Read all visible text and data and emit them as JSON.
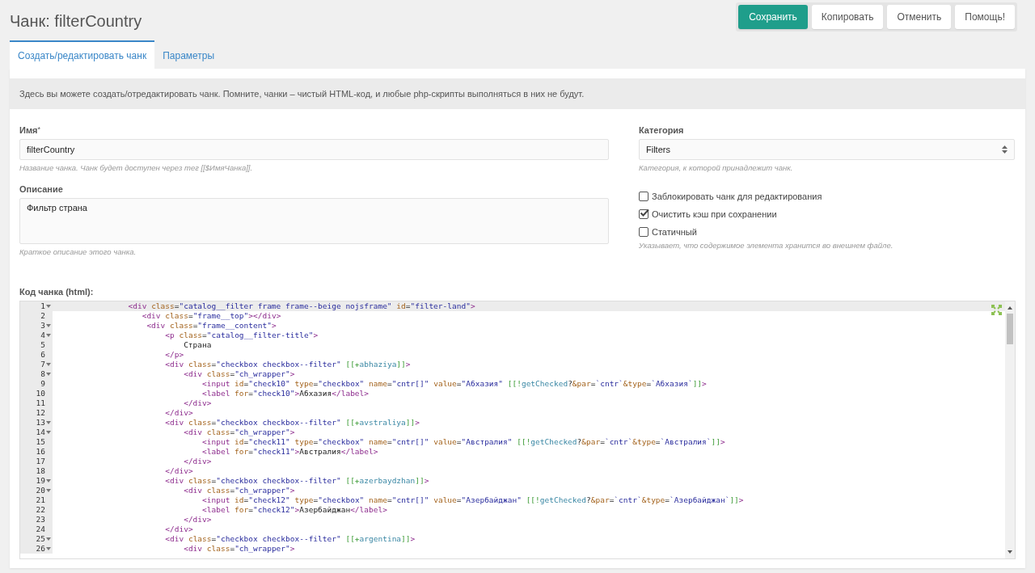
{
  "title": "Чанк: filterCountry",
  "buttons": [
    {
      "label": "Сохранить",
      "kind": "primary"
    },
    {
      "label": "Копировать",
      "kind": "default"
    },
    {
      "label": "Отменить",
      "kind": "default"
    },
    {
      "label": "Помощь!",
      "kind": "default"
    }
  ],
  "tabs": [
    {
      "label": "Создать/редактировать чанк",
      "selected": true
    },
    {
      "label": "Параметры",
      "selected": false
    }
  ],
  "notice": "Здесь вы можете создать/отредактировать чанк. Помните, чанки – чистый HTML-код, и любые php-скрипты выполняться в них не будут.",
  "name_field": {
    "label": "Имя",
    "required_mark": "*",
    "value": "filterCountry",
    "help": "Название чанка. Чанк будет доступен через тег [[$ИмяЧанка]]."
  },
  "description_field": {
    "label": "Описание",
    "value": "Фильтр страна",
    "help": "Краткое описание этого чанка."
  },
  "category_field": {
    "label": "Категория",
    "value": "Filters",
    "help": "Категория, к которой принадлежит чанк."
  },
  "options": [
    {
      "label": "Заблокировать чанк для редактирования",
      "checked": false
    },
    {
      "label": "Очистить кэш при сохранении",
      "checked": true
    },
    {
      "label": "Статичный",
      "checked": false
    }
  ],
  "options_help": "Указывает, что содержимое элемента хранится во внешнем файле.",
  "code": {
    "label": "Код чанка (html):",
    "lines": [
      {
        "number": "1",
        "fold": true,
        "active": true,
        "text": "                <div class=\"catalog__filter frame frame--beige nojsframe\" id=\"filter-land\">"
      },
      {
        "number": "2",
        "fold": false,
        "active": false,
        "text": "                   <div class=\"frame__top\"></div>"
      },
      {
        "number": "3",
        "fold": true,
        "active": false,
        "text": "                    <div class=\"frame__content\">"
      },
      {
        "number": "4",
        "fold": true,
        "active": false,
        "text": "                        <p class=\"catalog__filter-title\">"
      },
      {
        "number": "5",
        "fold": false,
        "active": false,
        "text": "                            Страна"
      },
      {
        "number": "6",
        "fold": false,
        "active": false,
        "text": "                        </p>"
      },
      {
        "number": "7",
        "fold": true,
        "active": false,
        "text": "                        <div class=\"checkbox checkbox--filter\" [[+abhaziya]]>"
      },
      {
        "number": "8",
        "fold": true,
        "active": false,
        "text": "                            <div class=\"ch_wrapper\">"
      },
      {
        "number": "9",
        "fold": false,
        "active": false,
        "text": "                                <input id=\"check10\" type=\"checkbox\" name=\"cntr[]\" value=\"Абхазия\" [[!getChecked?&par=`cntr`&type=`Абхазия`]]>"
      },
      {
        "number": "10",
        "fold": false,
        "active": false,
        "text": "                                <label for=\"check10\">Абхазия</label>"
      },
      {
        "number": "11",
        "fold": false,
        "active": false,
        "text": "                            </div>"
      },
      {
        "number": "12",
        "fold": false,
        "active": false,
        "text": "                        </div>"
      },
      {
        "number": "13",
        "fold": true,
        "active": false,
        "text": "                        <div class=\"checkbox checkbox--filter\" [[+avstraliya]]>"
      },
      {
        "number": "14",
        "fold": true,
        "active": false,
        "text": "                            <div class=\"ch_wrapper\">"
      },
      {
        "number": "15",
        "fold": false,
        "active": false,
        "text": "                                <input id=\"check11\" type=\"checkbox\" name=\"cntr[]\" value=\"Австралия\" [[!getChecked?&par=`cntr`&type=`Австралия`]]>"
      },
      {
        "number": "16",
        "fold": false,
        "active": false,
        "text": "                                <label for=\"check11\">Австралия</label>"
      },
      {
        "number": "17",
        "fold": false,
        "active": false,
        "text": "                            </div>"
      },
      {
        "number": "18",
        "fold": false,
        "active": false,
        "text": "                        </div>"
      },
      {
        "number": "19",
        "fold": true,
        "active": false,
        "text": "                        <div class=\"checkbox checkbox--filter\" [[+azerbaydzhan]]>"
      },
      {
        "number": "20",
        "fold": true,
        "active": false,
        "text": "                            <div class=\"ch_wrapper\">"
      },
      {
        "number": "21",
        "fold": false,
        "active": false,
        "text": "                                <input id=\"check12\" type=\"checkbox\" name=\"cntr[]\" value=\"Азербайджан\" [[!getChecked?&par=`cntr`&type=`Азербайджан`]]>"
      },
      {
        "number": "22",
        "fold": false,
        "active": false,
        "text": "                                <label for=\"check12\">Азербайджан</label>"
      },
      {
        "number": "23",
        "fold": false,
        "active": false,
        "text": "                            </div>"
      },
      {
        "number": "24",
        "fold": false,
        "active": false,
        "text": "                        </div>"
      },
      {
        "number": "25",
        "fold": true,
        "active": false,
        "text": "                        <div class=\"checkbox checkbox--filter\" [[+argentina]]>"
      },
      {
        "number": "26",
        "fold": true,
        "active": false,
        "text": "                            <div class=\"ch_wrapper\">"
      }
    ]
  }
}
